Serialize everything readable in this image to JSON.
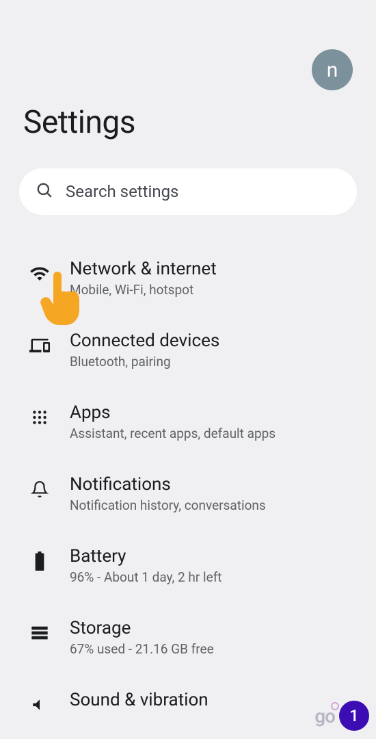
{
  "header": {
    "avatar_initial": "n"
  },
  "page_title": "Settings",
  "search": {
    "placeholder": "Search settings"
  },
  "items": [
    {
      "title": "Network & internet",
      "subtitle": "Mobile, Wi-Fi, hotspot"
    },
    {
      "title": "Connected devices",
      "subtitle": "Bluetooth, pairing"
    },
    {
      "title": "Apps",
      "subtitle": "Assistant, recent apps, default apps"
    },
    {
      "title": "Notifications",
      "subtitle": "Notification history, conversations"
    },
    {
      "title": "Battery",
      "subtitle": "96% - About 1 day, 2 hr left"
    },
    {
      "title": "Storage",
      "subtitle": "67% used - 21.16 GB free"
    },
    {
      "title": "Sound & vibration",
      "subtitle": ""
    }
  ],
  "badges": {
    "logo": "go",
    "number": "1"
  }
}
